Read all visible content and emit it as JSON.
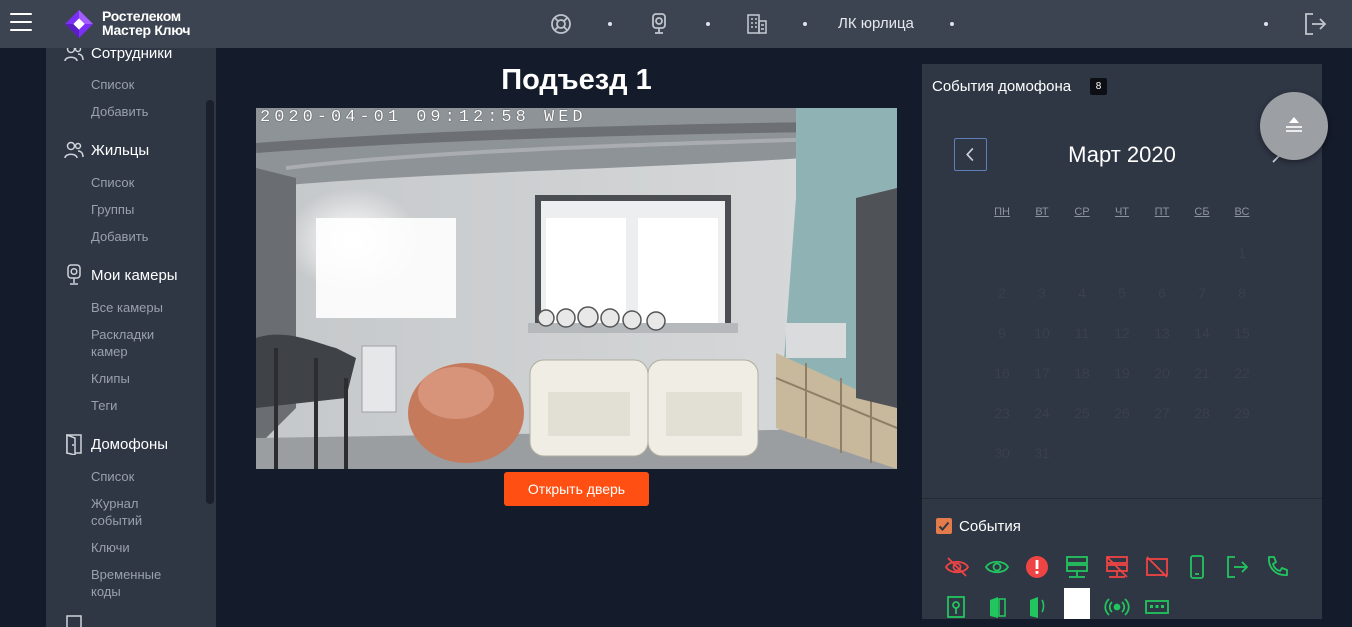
{
  "header": {
    "logo_line1": "Ростелеком",
    "logo_line2": "Мастер Ключ",
    "account_label": "ЛК юрлица",
    "icons": [
      "menu-icon",
      "support-icon",
      "camera-icon",
      "building-icon",
      "logout-icon"
    ]
  },
  "sidebar": {
    "sections": [
      {
        "label": "Сотрудники",
        "icon": "users-icon",
        "items": [
          "Список",
          "Добавить"
        ]
      },
      {
        "label": "Жильцы",
        "icon": "users-icon",
        "items": [
          "Список",
          "Группы",
          "Добавить"
        ]
      },
      {
        "label": "Мои камеры",
        "icon": "camera-icon",
        "items": [
          "Все камеры",
          "Раскладки камер",
          "Клипы",
          "Теги"
        ]
      },
      {
        "label": "Домофоны",
        "icon": "door-icon",
        "items": [
          "Список",
          "Журнал событий",
          "Ключи",
          "Временные коды"
        ]
      }
    ]
  },
  "main": {
    "title": "Подъезд 1",
    "camera_timestamp": "2020-04-01 09:12:58 WED",
    "open_door_label": "Открыть дверь"
  },
  "events": {
    "title": "События домофона",
    "badge": "8",
    "month": "Март 2020",
    "weekdays": [
      "ПН",
      "ВТ",
      "СР",
      "ЧТ",
      "ПТ",
      "СБ",
      "ВС"
    ],
    "days": [
      "1",
      "2",
      "3",
      "4",
      "5",
      "6",
      "7",
      "8",
      "9",
      "10",
      "11",
      "12",
      "13",
      "14",
      "15",
      "16",
      "17",
      "18",
      "19",
      "20",
      "21",
      "22",
      "23",
      "24",
      "25",
      "26",
      "27",
      "28",
      "29",
      "30",
      "31"
    ],
    "first_weekday_index": 6,
    "filter_label": "События",
    "filter_checked": true,
    "event_icons": [
      "eye-off-icon",
      "eye-icon",
      "alert-icon",
      "server-icon",
      "server-error-icon",
      "device-off-icon",
      "phone-icon",
      "exit-icon",
      "call-icon",
      "key-card-icon",
      "door-key-icon",
      "door-open-icon",
      "blank-tile",
      "signal-icon",
      "keypad-icon"
    ]
  },
  "colors": {
    "accent": "#ff4f12",
    "topbar": "#3d4451",
    "panel": "#2f3644",
    "background": "#141b2a",
    "event_green": "#22c55e",
    "event_red": "#ef4444"
  }
}
